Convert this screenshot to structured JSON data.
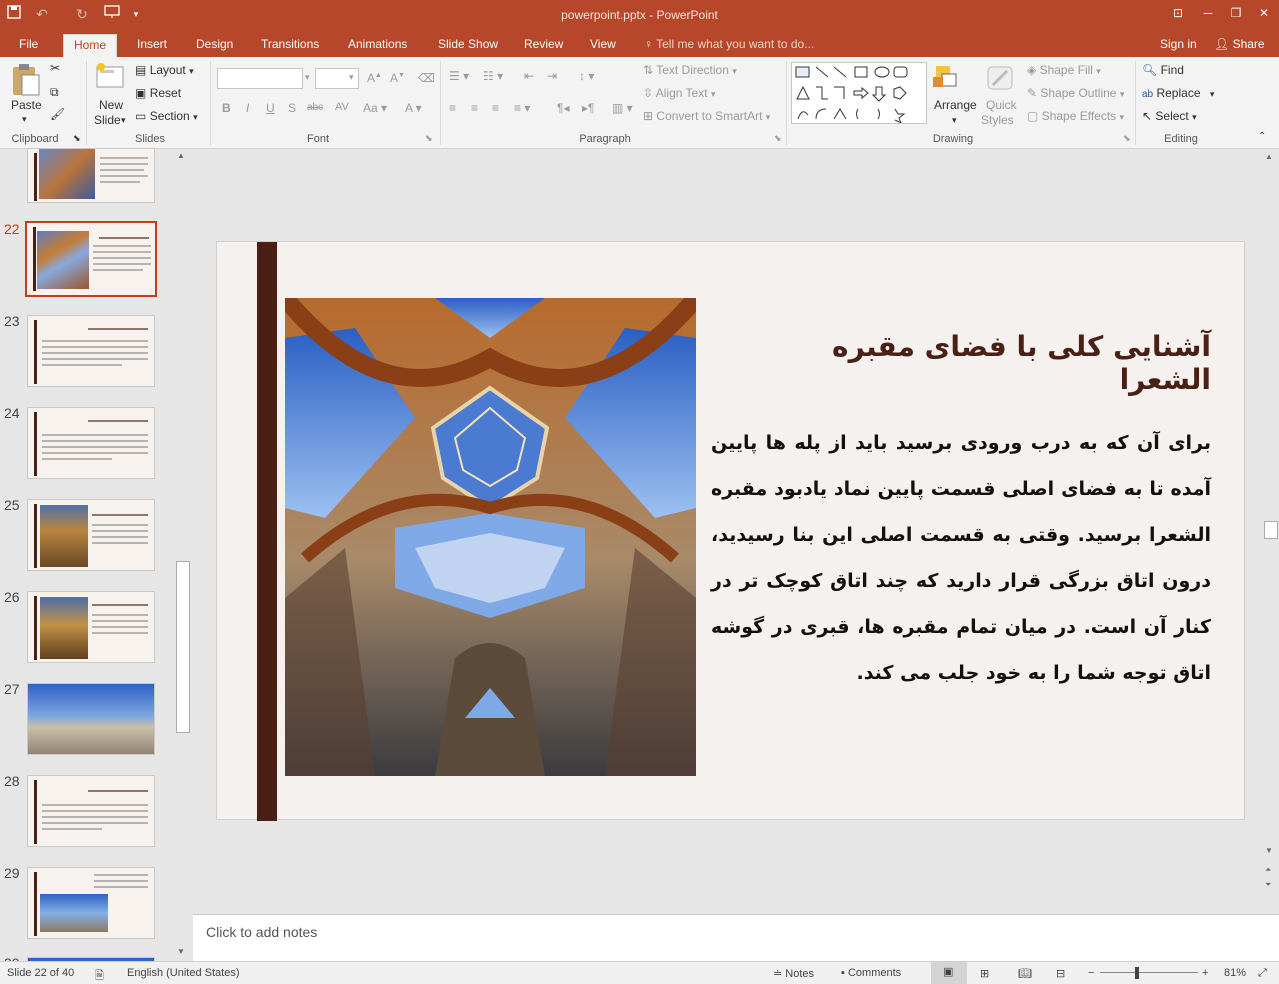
{
  "window": {
    "title": "powerpoint.pptx - PowerPoint",
    "accent": "#b7472a"
  },
  "tabs": [
    {
      "label": "File"
    },
    {
      "label": "Home"
    },
    {
      "label": "Insert"
    },
    {
      "label": "Design"
    },
    {
      "label": "Transitions"
    },
    {
      "label": "Animations"
    },
    {
      "label": "Slide Show"
    },
    {
      "label": "Review"
    },
    {
      "label": "View"
    }
  ],
  "tell_me": "Tell me what you want to do...",
  "sign_in": "Sign in",
  "share": "Share",
  "ribbon": {
    "clipboard": {
      "paste": "Paste",
      "label": "Clipboard"
    },
    "slides": {
      "new_slide_1": "New",
      "new_slide_2": "Slide",
      "layout": "Layout",
      "reset": "Reset",
      "section": "Section",
      "label": "Slides"
    },
    "font": {
      "label": "Font"
    },
    "paragraph": {
      "text_direction": "Text Direction",
      "align_text": "Align Text",
      "convert_smartart": "Convert to SmartArt",
      "label": "Paragraph"
    },
    "drawing": {
      "arrange": "Arrange",
      "quick_styles_1": "Quick",
      "quick_styles_2": "Styles",
      "shape_fill": "Shape Fill",
      "shape_outline": "Shape Outline",
      "shape_effects": "Shape Effects",
      "label": "Drawing"
    },
    "editing": {
      "find": "Find",
      "replace": "Replace",
      "select": "Select",
      "label": "Editing"
    }
  },
  "thumbnails": [
    {
      "num": "22"
    },
    {
      "num": "23"
    },
    {
      "num": "24"
    },
    {
      "num": "25"
    },
    {
      "num": "26"
    },
    {
      "num": "27"
    },
    {
      "num": "28"
    },
    {
      "num": "29"
    }
  ],
  "slide": {
    "title": "آشنایی کلی با فضای مقبره الشعرا",
    "body": "برای آن که به درب ورودی برسید باید از پله ها پایین آمده تا به فضای اصلی قسمت پایین نماد یادبود مقبره الشعرا برسید. وقتی به قسمت اصلی این بنا رسیدید، درون اتاق بزرگی قرار دارید که چند اتاق کوچک تر در کنار آن است. در میان تمام مقبره ها، قبری در گوشه اتاق توجه شما را به خود جلب می کند.",
    "accent": "#4a1f14"
  },
  "notes_placeholder": "Click to add notes",
  "status": {
    "slide_counter": "Slide 22 of 40",
    "language": "English (United States)",
    "notes": "Notes",
    "comments": "Comments",
    "zoom": "81%"
  }
}
